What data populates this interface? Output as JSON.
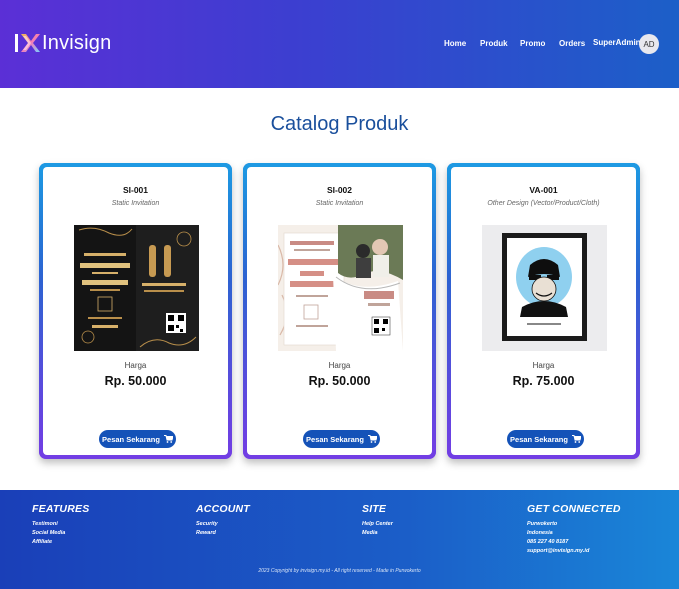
{
  "brand": {
    "name": "Invisign"
  },
  "nav": {
    "items": [
      {
        "label": "Home"
      },
      {
        "label": "Produk"
      },
      {
        "label": "Promo"
      },
      {
        "label": "Orders"
      },
      {
        "label": "SuperAdmin"
      }
    ],
    "avatar": "AD"
  },
  "page": {
    "title": "Catalog Produk"
  },
  "products": [
    {
      "code": "SI-001",
      "type": "Static Invitation",
      "price_label": "Harga",
      "price": "Rp. 50.000",
      "button": "Pesan Sekarang"
    },
    {
      "code": "SI-002",
      "type": "Static Invitation",
      "price_label": "Harga",
      "price": "Rp. 50.000",
      "button": "Pesan Sekarang"
    },
    {
      "code": "VA-001",
      "type": "Other Design (Vector/Product/Cloth)",
      "price_label": "Harga",
      "price": "Rp. 75.000",
      "button": "Pesan Sekarang"
    }
  ],
  "footer": {
    "features": {
      "heading": "FEATURES",
      "items": [
        "Testimoni",
        "Social Media",
        "Affiliate"
      ]
    },
    "account": {
      "heading": "ACCOUNT",
      "items": [
        "Security",
        "Reward"
      ]
    },
    "site": {
      "heading": "SITE",
      "items": [
        "Help Center",
        "Media"
      ]
    },
    "connected": {
      "heading": "GET CONNECTED",
      "items": [
        "Purwokerto",
        "Indonesia",
        "085 227 40 8187",
        "support@invisign.my.id"
      ]
    },
    "copyright": "2023 Copyright by invisign.my.id - All right reserved - Made in Purwokerto"
  },
  "colors": {
    "nav_start": "#5b2fd6",
    "nav_end": "#1c5fc8",
    "title": "#1a4f9c",
    "button": "#1452b8",
    "footer_start": "#1a3fb8",
    "footer_end": "#1a86d8"
  }
}
